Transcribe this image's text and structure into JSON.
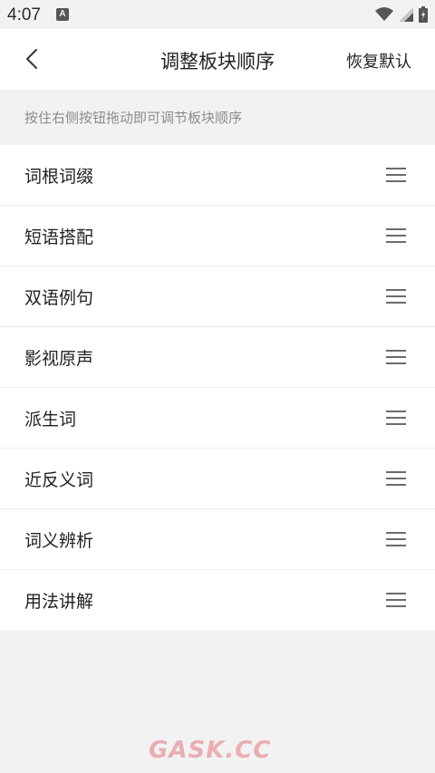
{
  "status_bar": {
    "time": "4:07",
    "notification_icon_letter": "A",
    "icons": [
      "wifi-icon",
      "signal-icon",
      "battery-icon"
    ]
  },
  "header": {
    "back_icon": "chevron-left-icon",
    "title": "调整板块顺序",
    "reset_label": "恢复默认"
  },
  "hint": "按住右侧按钮拖动即可调节板块顺序",
  "sections": [
    {
      "label": "词根词缀",
      "handle_icon": "drag-handle-icon"
    },
    {
      "label": "短语搭配",
      "handle_icon": "drag-handle-icon"
    },
    {
      "label": "双语例句",
      "handle_icon": "drag-handle-icon"
    },
    {
      "label": "影视原声",
      "handle_icon": "drag-handle-icon"
    },
    {
      "label": "派生词",
      "handle_icon": "drag-handle-icon"
    },
    {
      "label": "近反义词",
      "handle_icon": "drag-handle-icon"
    },
    {
      "label": "词义辨析",
      "handle_icon": "drag-handle-icon"
    },
    {
      "label": "用法讲解",
      "handle_icon": "drag-handle-icon"
    }
  ],
  "watermark": "GASK.CC",
  "colors": {
    "background": "#f2f2f2",
    "surface": "#ffffff",
    "text": "#222222",
    "hint_text": "#8c8c8c",
    "watermark": "#e9aeb2"
  }
}
